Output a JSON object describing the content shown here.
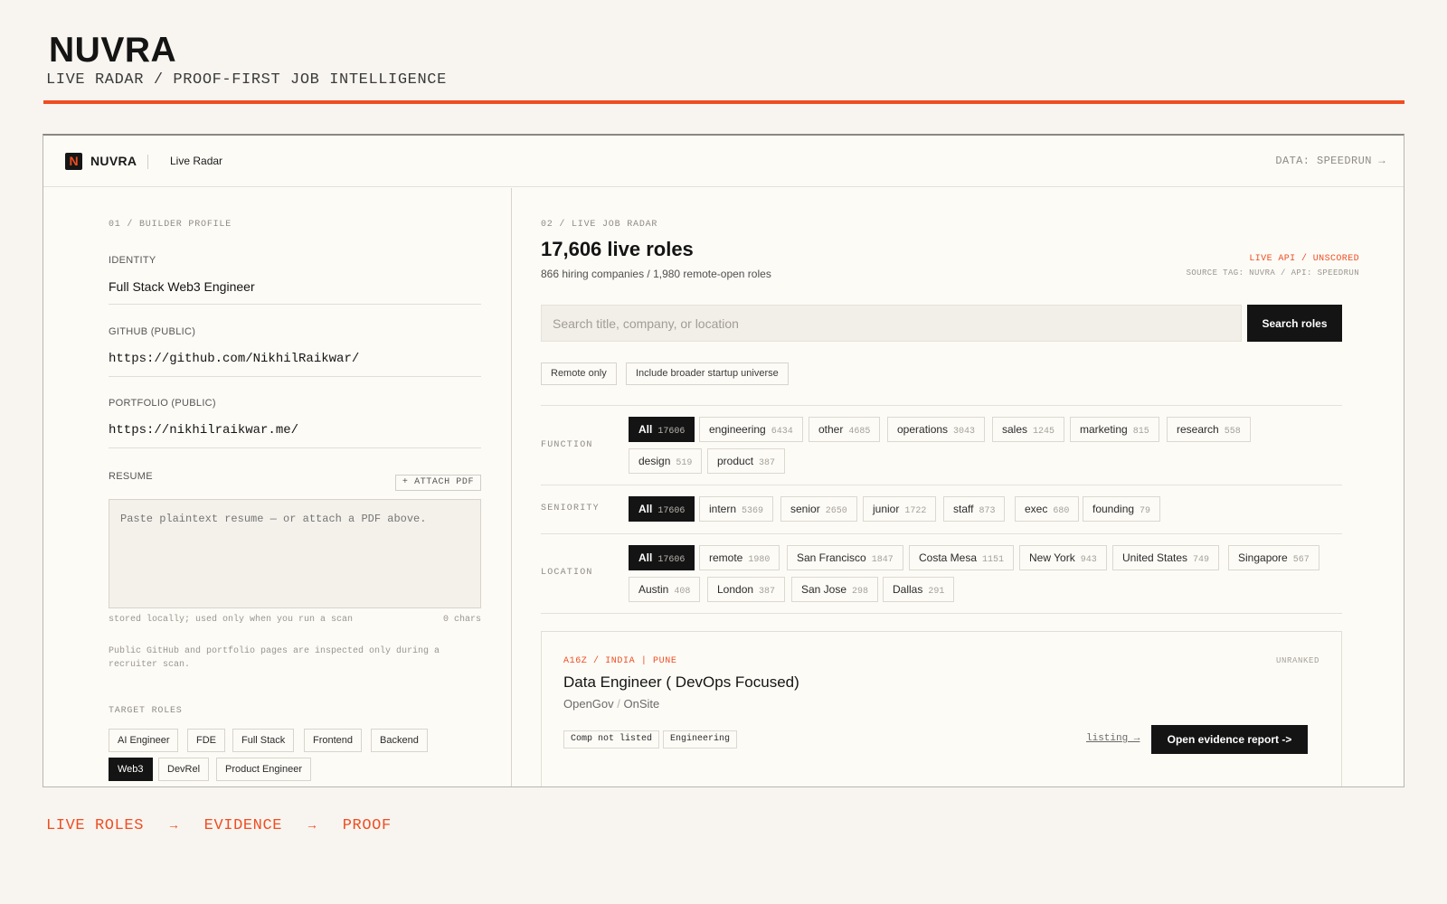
{
  "brand": {
    "title": "NUVRA",
    "subtitle": "LIVE RADAR / PROOF-FIRST JOB INTELLIGENCE",
    "accent_color": "#ef4d22"
  },
  "topbar": {
    "logo_glyph": "N",
    "logo_text": "NUVRA",
    "nav_label": "Live Radar",
    "data_label": "DATA: SPEEDRUN →"
  },
  "profile": {
    "section_label": "01 / BUILDER PROFILE",
    "identity_label": "IDENTITY",
    "identity_value": "Full Stack Web3 Engineer",
    "github_label": "GITHUB (PUBLIC)",
    "github_value": "https://github.com/NikhilRaikwar/",
    "portfolio_label": "PORTFOLIO (PUBLIC)",
    "portfolio_value": "https://nikhilraikwar.me/",
    "resume_label": "RESUME",
    "attach_label": "+ ATTACH PDF",
    "resume_placeholder": "Paste plaintext resume — or attach a PDF above.",
    "storage_note": "stored locally; used only when you run a scan",
    "char_count": "0 chars",
    "privacy_note": "Public GitHub and portfolio pages are inspected only during a recruiter scan.",
    "target_roles_label": "TARGET ROLES",
    "target_roles": [
      {
        "label": "AI Engineer",
        "active": false
      },
      {
        "label": "FDE",
        "active": false
      },
      {
        "label": "Full Stack",
        "active": false
      },
      {
        "label": "Frontend",
        "active": false
      },
      {
        "label": "Backend",
        "active": false
      },
      {
        "label": "Web3",
        "active": true
      },
      {
        "label": "DevRel",
        "active": false
      },
      {
        "label": "Product Engineer",
        "active": false
      }
    ]
  },
  "radar": {
    "section_label": "02 / LIVE JOB RADAR",
    "headline": "17,606 live roles",
    "subline": "866 hiring companies / 1,980 remote-open roles",
    "live_tag": "LIVE API / UNSCORED",
    "source_tag": "SOURCE TAG: NUVRA / API: SPEEDRUN",
    "search_placeholder": "Search title, company, or location",
    "search_button": "Search roles",
    "toggles": [
      "Remote only",
      "Include broader startup universe"
    ],
    "filters": {
      "function": {
        "label": "FUNCTION",
        "chips": [
          {
            "label": "All",
            "count": "17606",
            "active": true
          },
          {
            "label": "engineering",
            "count": "6434",
            "active": false
          },
          {
            "label": "other",
            "count": "4685",
            "active": false
          },
          {
            "label": "operations",
            "count": "3043",
            "active": false
          },
          {
            "label": "sales",
            "count": "1245",
            "active": false
          },
          {
            "label": "marketing",
            "count": "815",
            "active": false
          },
          {
            "label": "research",
            "count": "558",
            "active": false
          },
          {
            "label": "design",
            "count": "519",
            "active": false
          },
          {
            "label": "product",
            "count": "387",
            "active": false
          }
        ]
      },
      "seniority": {
        "label": "SENIORITY",
        "chips": [
          {
            "label": "All",
            "count": "17606",
            "active": true
          },
          {
            "label": "intern",
            "count": "5369",
            "active": false
          },
          {
            "label": "senior",
            "count": "2650",
            "active": false
          },
          {
            "label": "junior",
            "count": "1722",
            "active": false
          },
          {
            "label": "staff",
            "count": "873",
            "active": false
          },
          {
            "label": "exec",
            "count": "680",
            "active": false
          },
          {
            "label": "founding",
            "count": "79",
            "active": false
          }
        ]
      },
      "location": {
        "label": "LOCATION",
        "chips": [
          {
            "label": "All",
            "count": "17606",
            "active": true
          },
          {
            "label": "remote",
            "count": "1980",
            "active": false
          },
          {
            "label": "San Francisco",
            "count": "1847",
            "active": false
          },
          {
            "label": "Costa Mesa",
            "count": "1151",
            "active": false
          },
          {
            "label": "New York",
            "count": "943",
            "active": false
          },
          {
            "label": "United States",
            "count": "749",
            "active": false
          },
          {
            "label": "Singapore",
            "count": "567",
            "active": false
          },
          {
            "label": "Austin",
            "count": "408",
            "active": false
          },
          {
            "label": "London",
            "count": "387",
            "active": false
          },
          {
            "label": "San Jose",
            "count": "298",
            "active": false
          },
          {
            "label": "Dallas",
            "count": "291",
            "active": false
          }
        ]
      }
    },
    "job": {
      "meta": "A16Z / INDIA | PUNE",
      "rank": "UNRANKED",
      "title": "Data Engineer ( DevOps Focused)",
      "company": "OpenGov",
      "work_mode": "OnSite",
      "tags": [
        "Comp not listed",
        "Engineering"
      ],
      "listing_label": "listing →",
      "evidence_button": "Open evidence report ->"
    }
  },
  "footer": {
    "steps": [
      "LIVE ROLES",
      "EVIDENCE",
      "PROOF"
    ],
    "separator": "→"
  }
}
